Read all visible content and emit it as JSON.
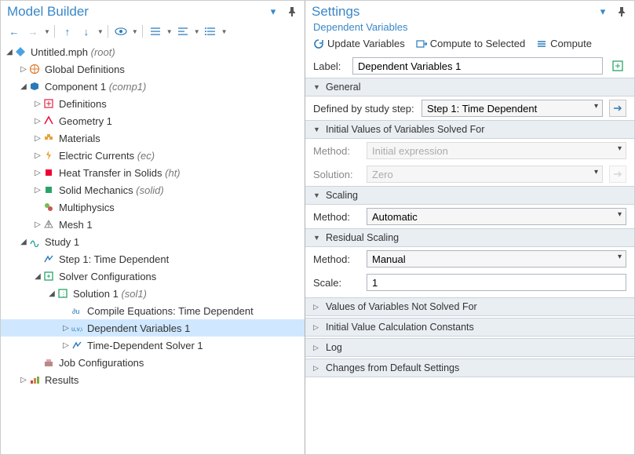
{
  "left_panel": {
    "title": "Model Builder",
    "tree": {
      "root": {
        "label": "Untitled.mph",
        "suffix": "(root)"
      },
      "global_defs": "Global Definitions",
      "component": {
        "label": "Component 1",
        "suffix": "(comp1)"
      },
      "definitions": "Definitions",
      "geometry": "Geometry 1",
      "materials": "Materials",
      "electric": {
        "label": "Electric Currents",
        "suffix": "(ec)"
      },
      "heat": {
        "label": "Heat Transfer in Solids",
        "suffix": "(ht)"
      },
      "solid": {
        "label": "Solid Mechanics",
        "suffix": "(solid)"
      },
      "multiphysics": "Multiphysics",
      "mesh": "Mesh 1",
      "study": "Study 1",
      "step1": "Step 1: Time Dependent",
      "solver_conf": "Solver Configurations",
      "solution1": {
        "label": "Solution 1",
        "suffix": "(sol1)"
      },
      "compile_eq": "Compile Equations: Time Dependent",
      "dep_vars": "Dependent Variables 1",
      "td_solver": "Time-Dependent Solver 1",
      "job_conf": "Job Configurations",
      "results": "Results"
    }
  },
  "right_panel": {
    "title": "Settings",
    "subtitle": "Dependent Variables",
    "actions": {
      "update": "Update Variables",
      "compute_sel": "Compute to Selected",
      "compute": "Compute"
    },
    "label_field": {
      "label": "Label:",
      "value": "Dependent Variables 1"
    },
    "sections": {
      "general": "General",
      "init_solved": "Initial Values of Variables Solved For",
      "scaling": "Scaling",
      "resid": "Residual Scaling",
      "not_solved": "Values of Variables Not Solved For",
      "init_calc": "Initial Value Calculation Constants",
      "log": "Log",
      "changes": "Changes from Default Settings"
    },
    "general": {
      "defined_by": "Defined by study step:",
      "step": "Step 1: Time Dependent"
    },
    "init_solved": {
      "method_label": "Method:",
      "method_value": "Initial expression",
      "solution_label": "Solution:",
      "solution_value": "Zero"
    },
    "scaling": {
      "method_label": "Method:",
      "method_value": "Automatic"
    },
    "resid": {
      "method_label": "Method:",
      "method_value": "Manual",
      "scale_label": "Scale:",
      "scale_value": "1"
    }
  }
}
